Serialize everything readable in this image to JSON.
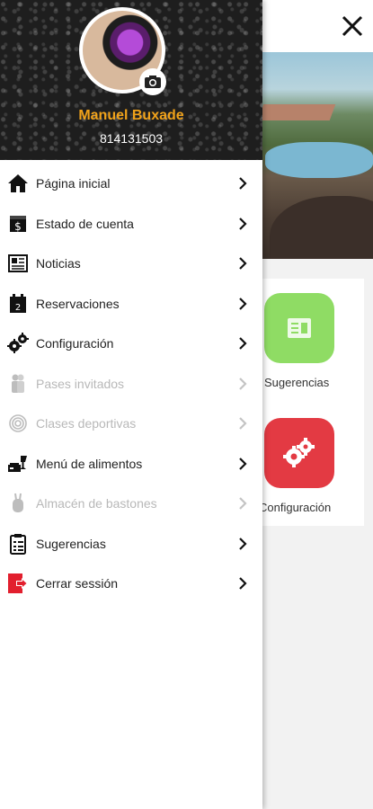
{
  "profile": {
    "name": "Manuel Buxade",
    "member_id": "814131503"
  },
  "menu": [
    {
      "label": "Página inicial",
      "icon": "home-icon",
      "enabled": true
    },
    {
      "label": "Estado de cuenta",
      "icon": "dollar-doc-icon",
      "enabled": true
    },
    {
      "label": "Noticias",
      "icon": "newspaper-icon",
      "enabled": true
    },
    {
      "label": "Reservaciones",
      "icon": "calendar-icon",
      "enabled": true
    },
    {
      "label": "Configuración",
      "icon": "gears-icon",
      "enabled": true
    },
    {
      "label": "Pases invitados",
      "icon": "guests-icon",
      "enabled": false
    },
    {
      "label": "Clases deportivas",
      "icon": "fingerprint-icon",
      "enabled": false
    },
    {
      "label": "Menú de alimentos",
      "icon": "food-icon",
      "enabled": true
    },
    {
      "label": "Almacén de bastones",
      "icon": "golf-bag-icon",
      "enabled": false
    },
    {
      "label": "Sugerencias",
      "icon": "clipboard-icon",
      "enabled": true
    },
    {
      "label": "Cerrar sessión",
      "icon": "logout-icon",
      "enabled": true
    }
  ],
  "background": {
    "tiles": [
      {
        "label": "Sugerencias",
        "color": "#8fdc64",
        "icon": "suggestions-icon"
      },
      {
        "label": "Configuración",
        "color": "#e33a43",
        "icon": "gears-icon"
      }
    ]
  },
  "colors": {
    "accent_name": "#f0a21a",
    "disabled_text": "#b8b8b8"
  }
}
